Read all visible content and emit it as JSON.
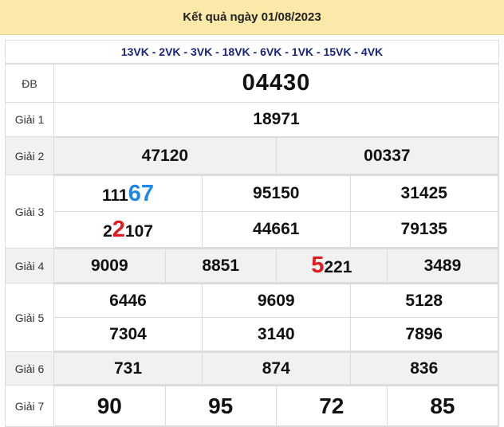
{
  "header": {
    "title": "Kết quả ngày 01/08/2023"
  },
  "codes": "13VK - 2VK - 3VK - 18VK - 6VK - 1VK - 15VK - 4VK",
  "prizes": {
    "db": {
      "label": "ĐB",
      "values": [
        "04430"
      ]
    },
    "g1": {
      "label": "Giải 1",
      "values": [
        "18971"
      ]
    },
    "g2": {
      "label": "Giải 2",
      "values": [
        "47120",
        "00337"
      ]
    },
    "g3": {
      "label": "Giải 3",
      "values": [
        "11167",
        "95150",
        "31425",
        "22107",
        "44661",
        "79135"
      ],
      "display": [
        {
          "prefix": "111",
          "highlight": "67",
          "suffix": ""
        },
        {
          "prefix": "2",
          "highlight": "2",
          "suffix": "107"
        }
      ]
    },
    "g4": {
      "label": "Giải 4",
      "values": [
        "9009",
        "8851",
        "5221",
        "3489"
      ],
      "display": {
        "prefix": "",
        "highlight": "5",
        "suffix": "221"
      }
    },
    "g5": {
      "label": "Giải 5",
      "values": [
        "6446",
        "9609",
        "5128",
        "7304",
        "3140",
        "7896"
      ]
    },
    "g6": {
      "label": "Giải 6",
      "values": [
        "731",
        "874",
        "836"
      ]
    },
    "g7": {
      "label": "Giải 7",
      "values": [
        "90",
        "95",
        "72",
        "85"
      ]
    }
  },
  "colors": {
    "header_bg": "#fbe9a9",
    "accent_red": "#e11b22",
    "accent_blue": "#1e88e5",
    "codes_text": "#1a237e",
    "alt_row": "#f1f1f1"
  }
}
